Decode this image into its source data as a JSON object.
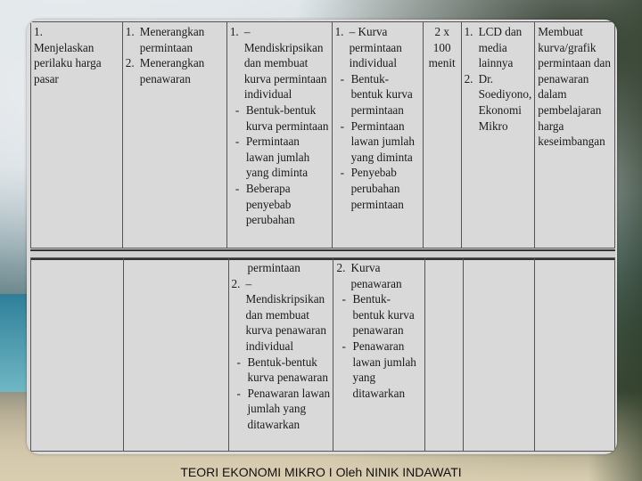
{
  "footer": "TEORI EKONOMI MIKRO I Oleh NINIK INDAWATI",
  "row1": {
    "kd_num": "1.",
    "kd": "Menjelaskan perilaku harga pasar",
    "ind": [
      {
        "n": "1.",
        "t": "Menerangkan permintaan"
      },
      {
        "n": "2.",
        "t": "Menerangkan penawaran"
      }
    ],
    "keg": {
      "n": "1.",
      "t": "– Mendiskripsikan dan membuat kurva permintaan individual",
      "subs": [
        "Bentuk-bentuk kurva permintaan",
        "Permintaan lawan jumlah yang diminta",
        "Beberapa penyebab perubahan"
      ]
    },
    "mat": {
      "n": "1.",
      "t": "– Kurva permintaan individual",
      "subs": [
        "Bentuk-bentuk kurva permintaan",
        "Permintaan lawan jumlah yang diminta",
        "Penyebab perubahan permintaan"
      ]
    },
    "waktu": "2 x 100 menit",
    "sumber": [
      {
        "n": "1.",
        "t": "LCD dan media lainnya"
      },
      {
        "n": "2.",
        "t": "Dr. Soediyono, Ekonomi Mikro"
      }
    ],
    "tugas": "Membuat kurva/grafik permintaan dan penawaran dalam pembelajaran harga keseimbangan"
  },
  "row2": {
    "keg_cont": "permintaan",
    "keg": {
      "n": "2.",
      "t": "– Mendiskripsikan dan membuat kurva penawaran individual",
      "subs": [
        "Bentuk-bentuk kurva penawaran",
        "Penawaran lawan jumlah yang ditawarkan"
      ]
    },
    "mat": {
      "n": "2.",
      "t": "Kurva penawaran",
      "subs": [
        "Bentuk-bentuk kurva penawaran",
        "Penawaran lawan jumlah yang ditawarkan"
      ]
    }
  }
}
